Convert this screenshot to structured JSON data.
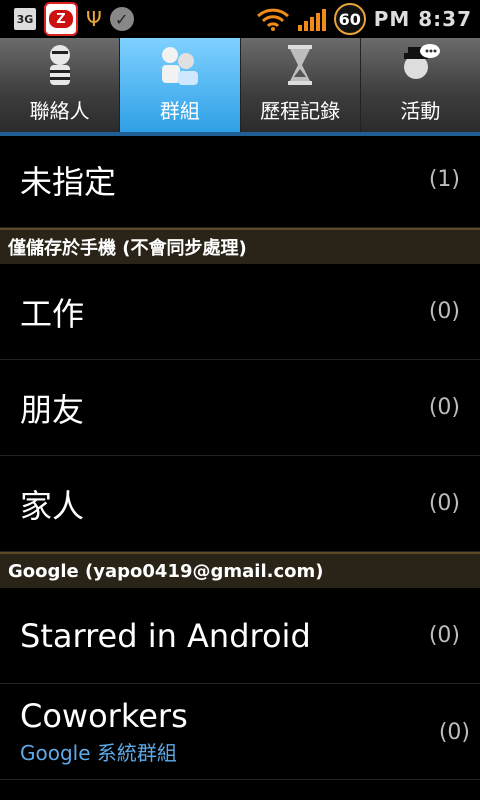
{
  "statusbar": {
    "network_badge": "3G",
    "app_badge": "Z",
    "battery_level": "60",
    "time": "PM 8:37",
    "accent": "#f08a19"
  },
  "tabs": [
    {
      "label": "聯絡人",
      "icon": "contacts-icon"
    },
    {
      "label": "群組",
      "icon": "groups-icon",
      "active": true
    },
    {
      "label": "歷程記錄",
      "icon": "history-icon"
    },
    {
      "label": "活動",
      "icon": "activity-icon"
    }
  ],
  "list": {
    "unassigned": {
      "name": "未指定",
      "count": "(1)"
    },
    "phone_header": "僅儲存於手機 (不會同步處理)",
    "phone_groups": [
      {
        "name": "工作",
        "count": "(0)"
      },
      {
        "name": "朋友",
        "count": "(0)"
      },
      {
        "name": "家人",
        "count": "(0)"
      }
    ],
    "google_header": "Google  (yapo0419@gmail.com)",
    "google_groups": [
      {
        "name": "Starred in Android",
        "count": "(0)"
      },
      {
        "name": "Coworkers",
        "count": "(0)",
        "sub": "Google 系統群組"
      }
    ]
  }
}
